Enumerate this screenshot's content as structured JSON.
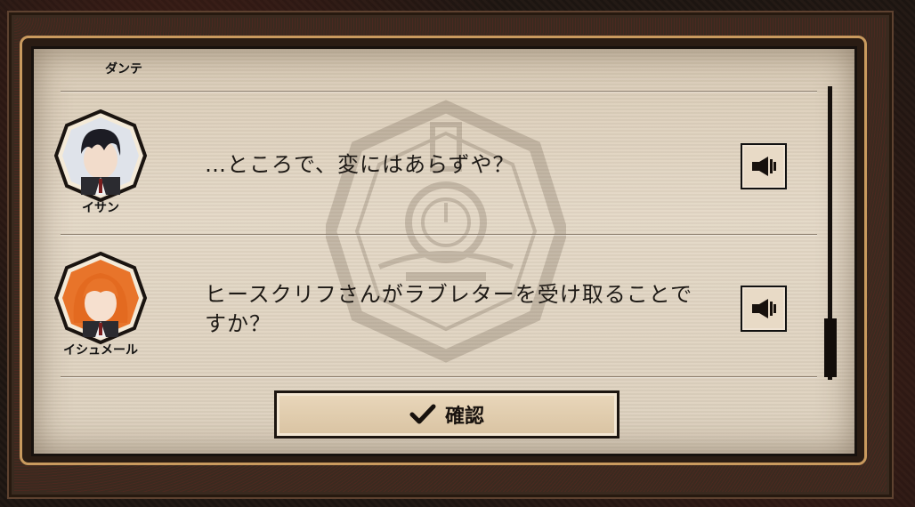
{
  "dialog": {
    "entries": [
      {
        "name": "ダンテ",
        "text": ""
      },
      {
        "name": "イサン",
        "text": "…ところで、変にはあらずや？"
      },
      {
        "name": "イシュメール",
        "text_line1": "ヒースクリフさんがラブレターを受け取ることで",
        "text_line2": "すか？"
      }
    ],
    "voice_icon": "speaker-icon",
    "confirm_label": "確認",
    "confirm_icon": "checkmark-icon"
  },
  "colors": {
    "panel": "#dcd0bd",
    "frame_accent": "#c99a5e",
    "ishmael_hair": "#e8742a",
    "yisang_hair": "#1c1c24"
  }
}
